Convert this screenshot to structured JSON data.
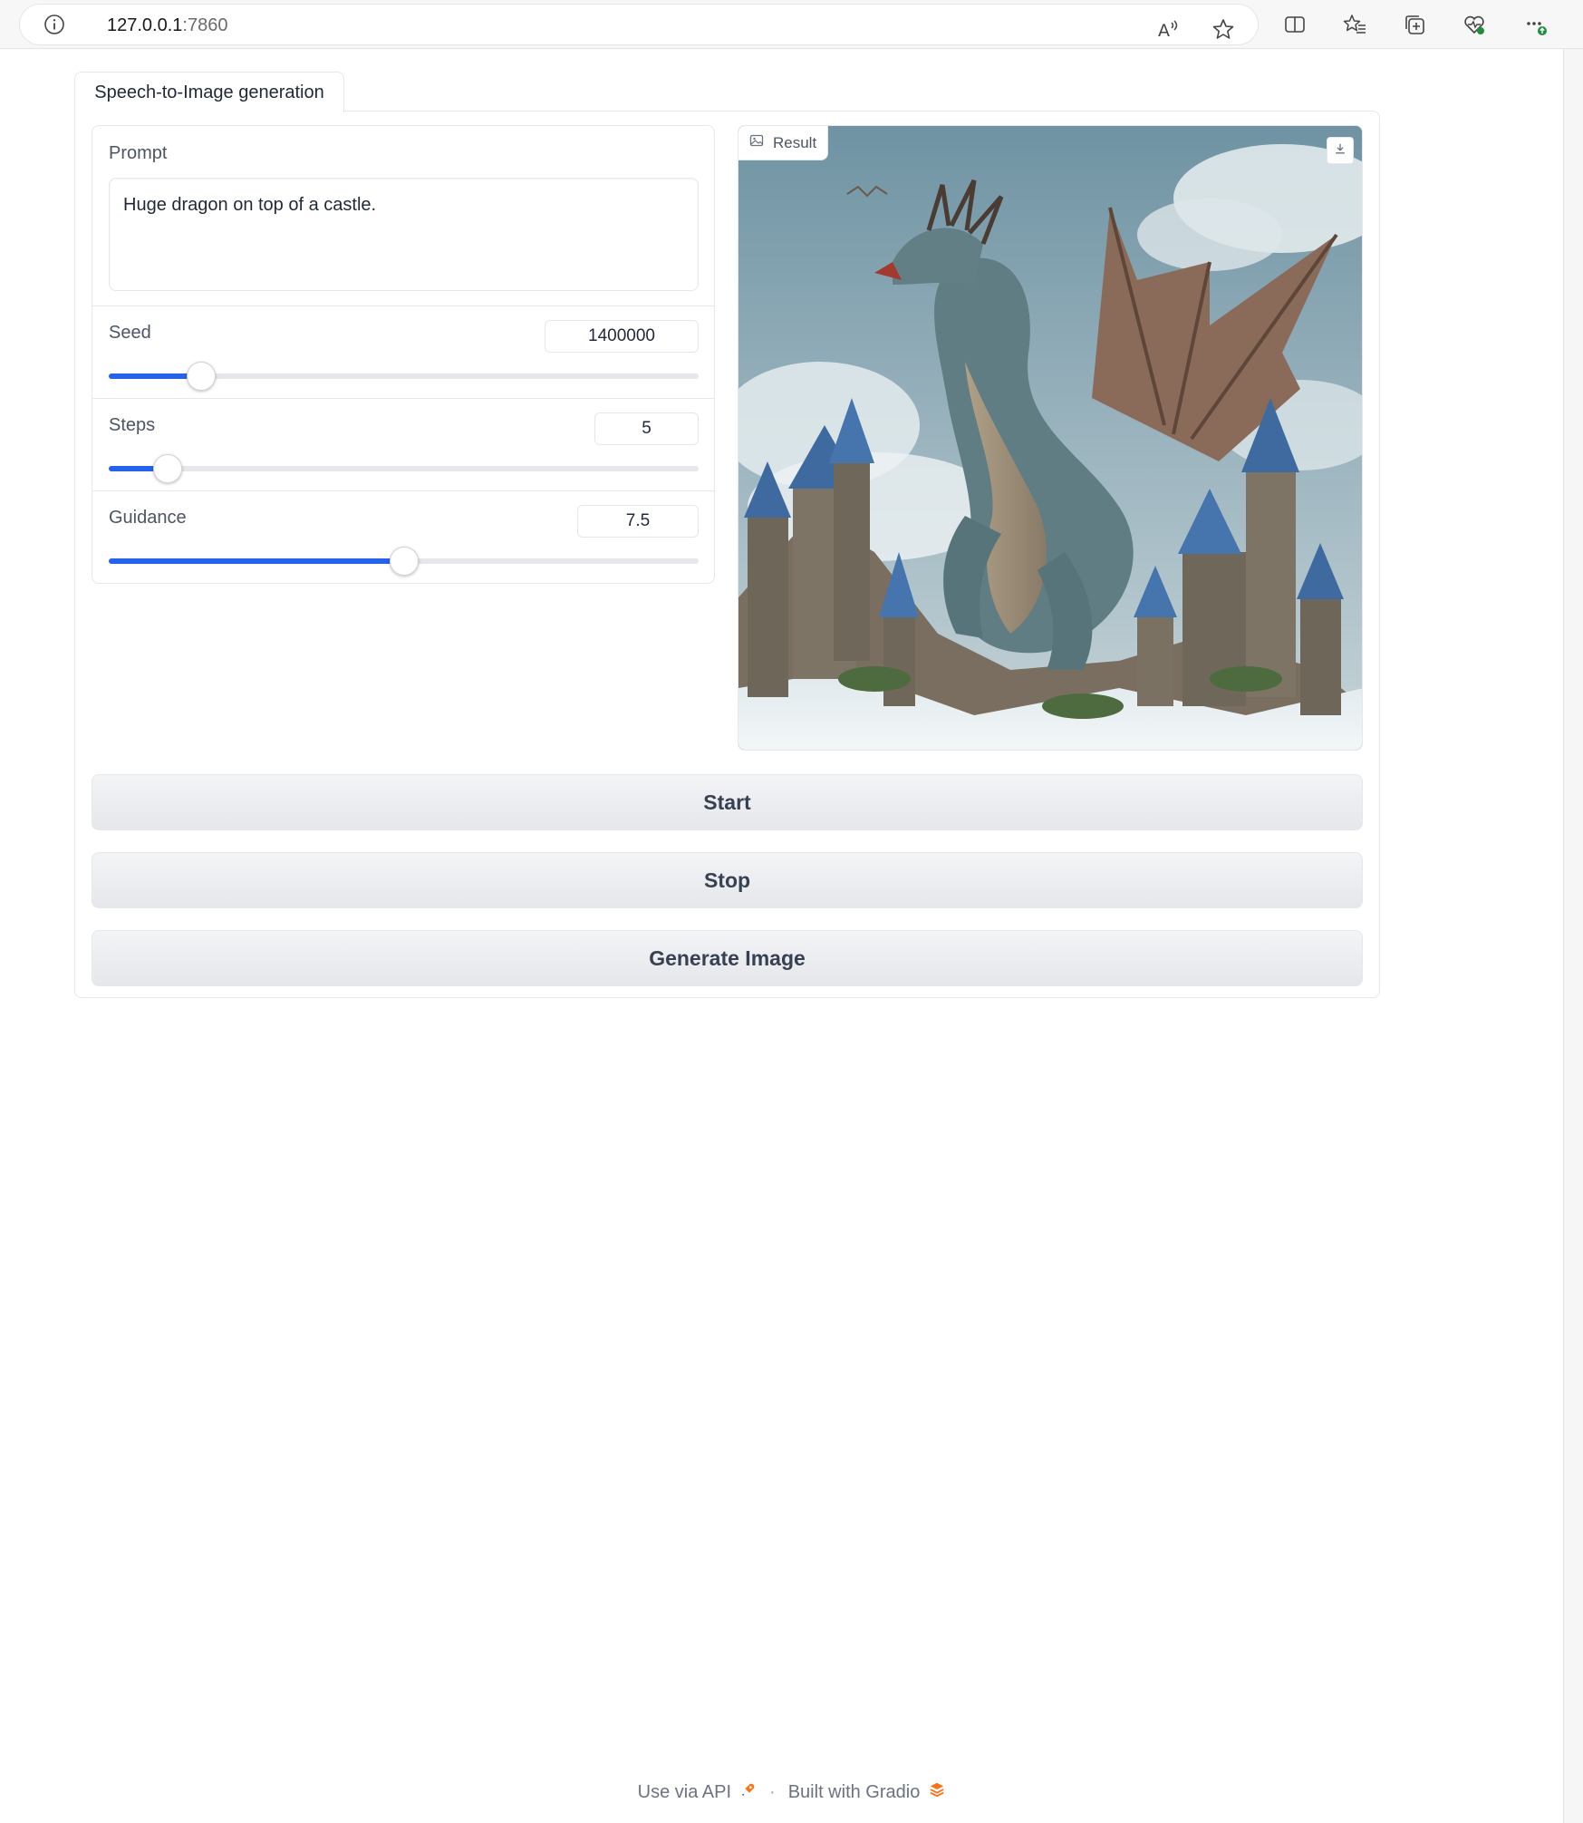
{
  "browser": {
    "url_host": "127.0.0.1",
    "url_port": ":7860"
  },
  "tabs": [
    {
      "label": "Speech-to-Image generation"
    }
  ],
  "prompt": {
    "label": "Prompt",
    "value": "Huge dragon on top of a castle."
  },
  "sliders": {
    "seed": {
      "label": "Seed",
      "value": "1400000",
      "fraction": 0.157
    },
    "steps": {
      "label": "Steps",
      "value": "5",
      "fraction": 0.1
    },
    "guidance": {
      "label": "Guidance",
      "value": "7.5",
      "fraction": 0.5
    }
  },
  "result": {
    "label": "Result"
  },
  "buttons": {
    "start": "Start",
    "stop": "Stop",
    "generate": "Generate Image"
  },
  "footer": {
    "api": "Use via API",
    "separator": "·",
    "built": "Built with Gradio"
  },
  "colors": {
    "accent": "#2563eb",
    "gradio_orange": "#f97316"
  }
}
